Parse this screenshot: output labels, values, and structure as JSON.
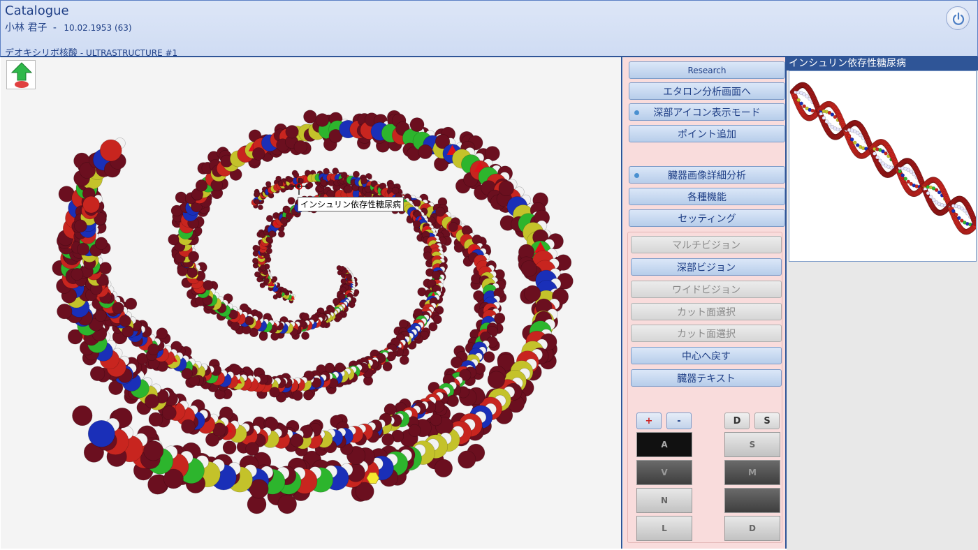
{
  "header": {
    "app_title": "Catalogue",
    "patient_name": "小林 君子",
    "patient_sep": "-",
    "patient_dob": "10.02.1953 (63)",
    "subtitle_jp": "デオキシリボ核酸",
    "subtitle_en": " - ULTRASTRUCTURE #1"
  },
  "viewport": {
    "tooltip": "インシュリン依存性糖尿病"
  },
  "panel": {
    "buttons_top": [
      {
        "label": "Research"
      },
      {
        "label": "エタロン分析画面へ"
      },
      {
        "label": "深部アイコン表示モード"
      },
      {
        "label": "ポイント追加"
      }
    ],
    "buttons_mid": [
      {
        "label": "臓器画像詳細分析"
      },
      {
        "label": "各種機能"
      },
      {
        "label": "セッティング"
      }
    ],
    "buttons_vision": [
      {
        "label": "マルチビジョン",
        "enabled": false
      },
      {
        "label": "深部ビジョン",
        "enabled": true
      },
      {
        "label": "ワイドビジョン",
        "enabled": false
      },
      {
        "label": "カット面選択",
        "enabled": false
      },
      {
        "label": "カット面選択",
        "enabled": false
      },
      {
        "label": "中心へ戻す",
        "enabled": true
      },
      {
        "label": "臓器テキスト",
        "enabled": true
      }
    ],
    "zoom_plus": "+",
    "zoom_minus": "-",
    "toggle_d": "D",
    "toggle_s": "S",
    "modes_left": [
      "A",
      "V",
      "N",
      "L"
    ],
    "modes_right": [
      "S",
      "M",
      "",
      "D"
    ]
  },
  "right_pane": {
    "title": "インシュリン依存性糖尿病"
  },
  "colors": {
    "accent": "#2f5597",
    "panel_bg": "#f9dcdc",
    "atom_maroon": "#6b0f1f",
    "atom_red": "#c8251f",
    "atom_green": "#2db52d",
    "atom_blue": "#1a2fb8",
    "atom_yellow": "#c4c22a",
    "atom_white": "#f2f2f2"
  }
}
